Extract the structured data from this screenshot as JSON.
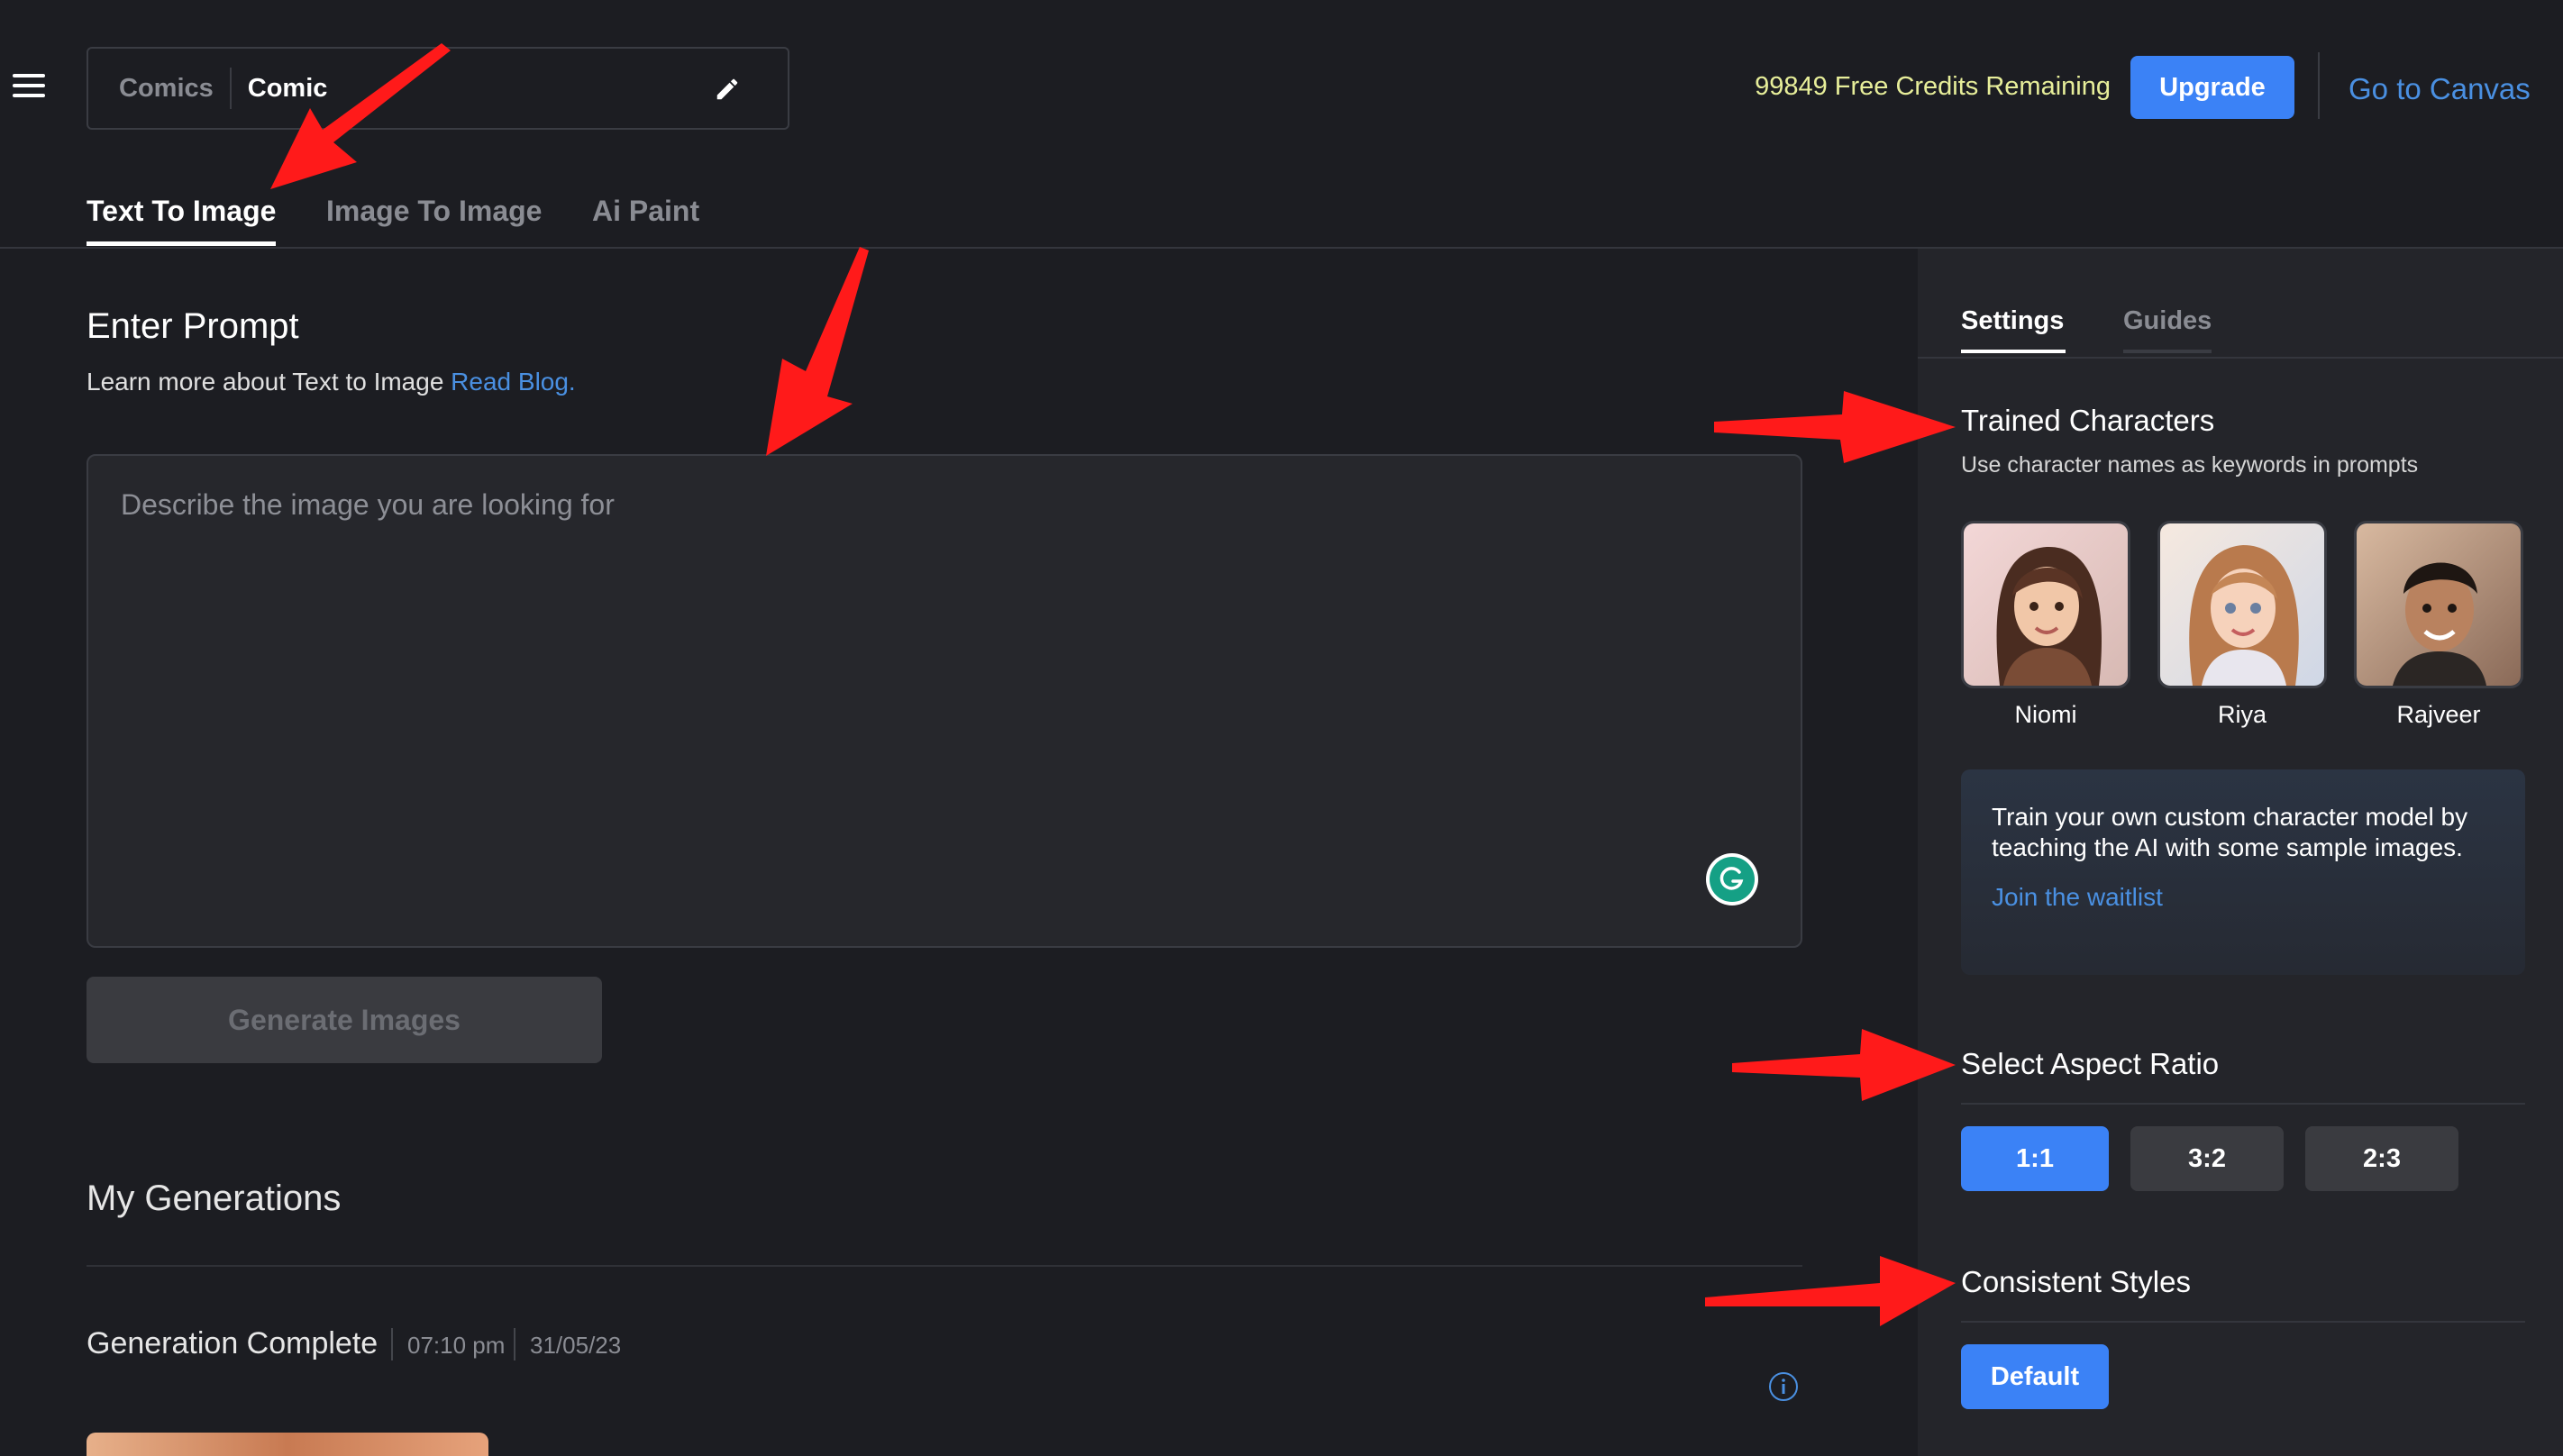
{
  "header": {
    "breadcrumb_parent": "Comics",
    "breadcrumb_current": "Comic",
    "credits_text": "99849 Free Credits Remaining",
    "upgrade_label": "Upgrade",
    "canvas_link": "Go to Canvas"
  },
  "tabs": [
    {
      "label": "Text To Image",
      "active": true
    },
    {
      "label": "Image To Image",
      "active": false
    },
    {
      "label": "Ai Paint",
      "active": false
    }
  ],
  "prompt": {
    "title": "Enter Prompt",
    "subtitle": "Learn more about Text to Image",
    "blog_link": "Read Blog.",
    "placeholder": "Describe the image you are looking for",
    "value": ""
  },
  "generate_label": "Generate Images",
  "generations": {
    "title": "My Generations",
    "status": "Generation Complete",
    "time": "07:10 pm",
    "date": "31/05/23"
  },
  "settings": {
    "tabs": [
      {
        "label": "Settings",
        "active": true
      },
      {
        "label": "Guides",
        "active": false
      }
    ],
    "trained_title": "Trained Characters",
    "trained_sub": "Use character names as keywords in prompts",
    "characters": [
      {
        "name": "Niomi"
      },
      {
        "name": "Riya"
      },
      {
        "name": "Rajveer"
      }
    ],
    "train_card_text": "Train your own custom character model by teaching the AI with some sample images.",
    "train_card_link": "Join the waitlist",
    "aspect_title": "Select Aspect Ratio",
    "aspect_options": [
      {
        "label": "1:1",
        "selected": true
      },
      {
        "label": "3:2",
        "selected": false
      },
      {
        "label": "2:3",
        "selected": false
      }
    ],
    "styles_title": "Consistent Styles",
    "style_default": "Default"
  },
  "colors": {
    "background": "#1c1d22",
    "panel": "#24252a",
    "accent": "#3b82f6",
    "link": "#4a90e2",
    "credits": "#e7ee9a",
    "annotation": "#ff1a1a"
  },
  "icons": [
    "menu-icon",
    "pencil-icon",
    "grammarly-icon",
    "info-icon"
  ]
}
